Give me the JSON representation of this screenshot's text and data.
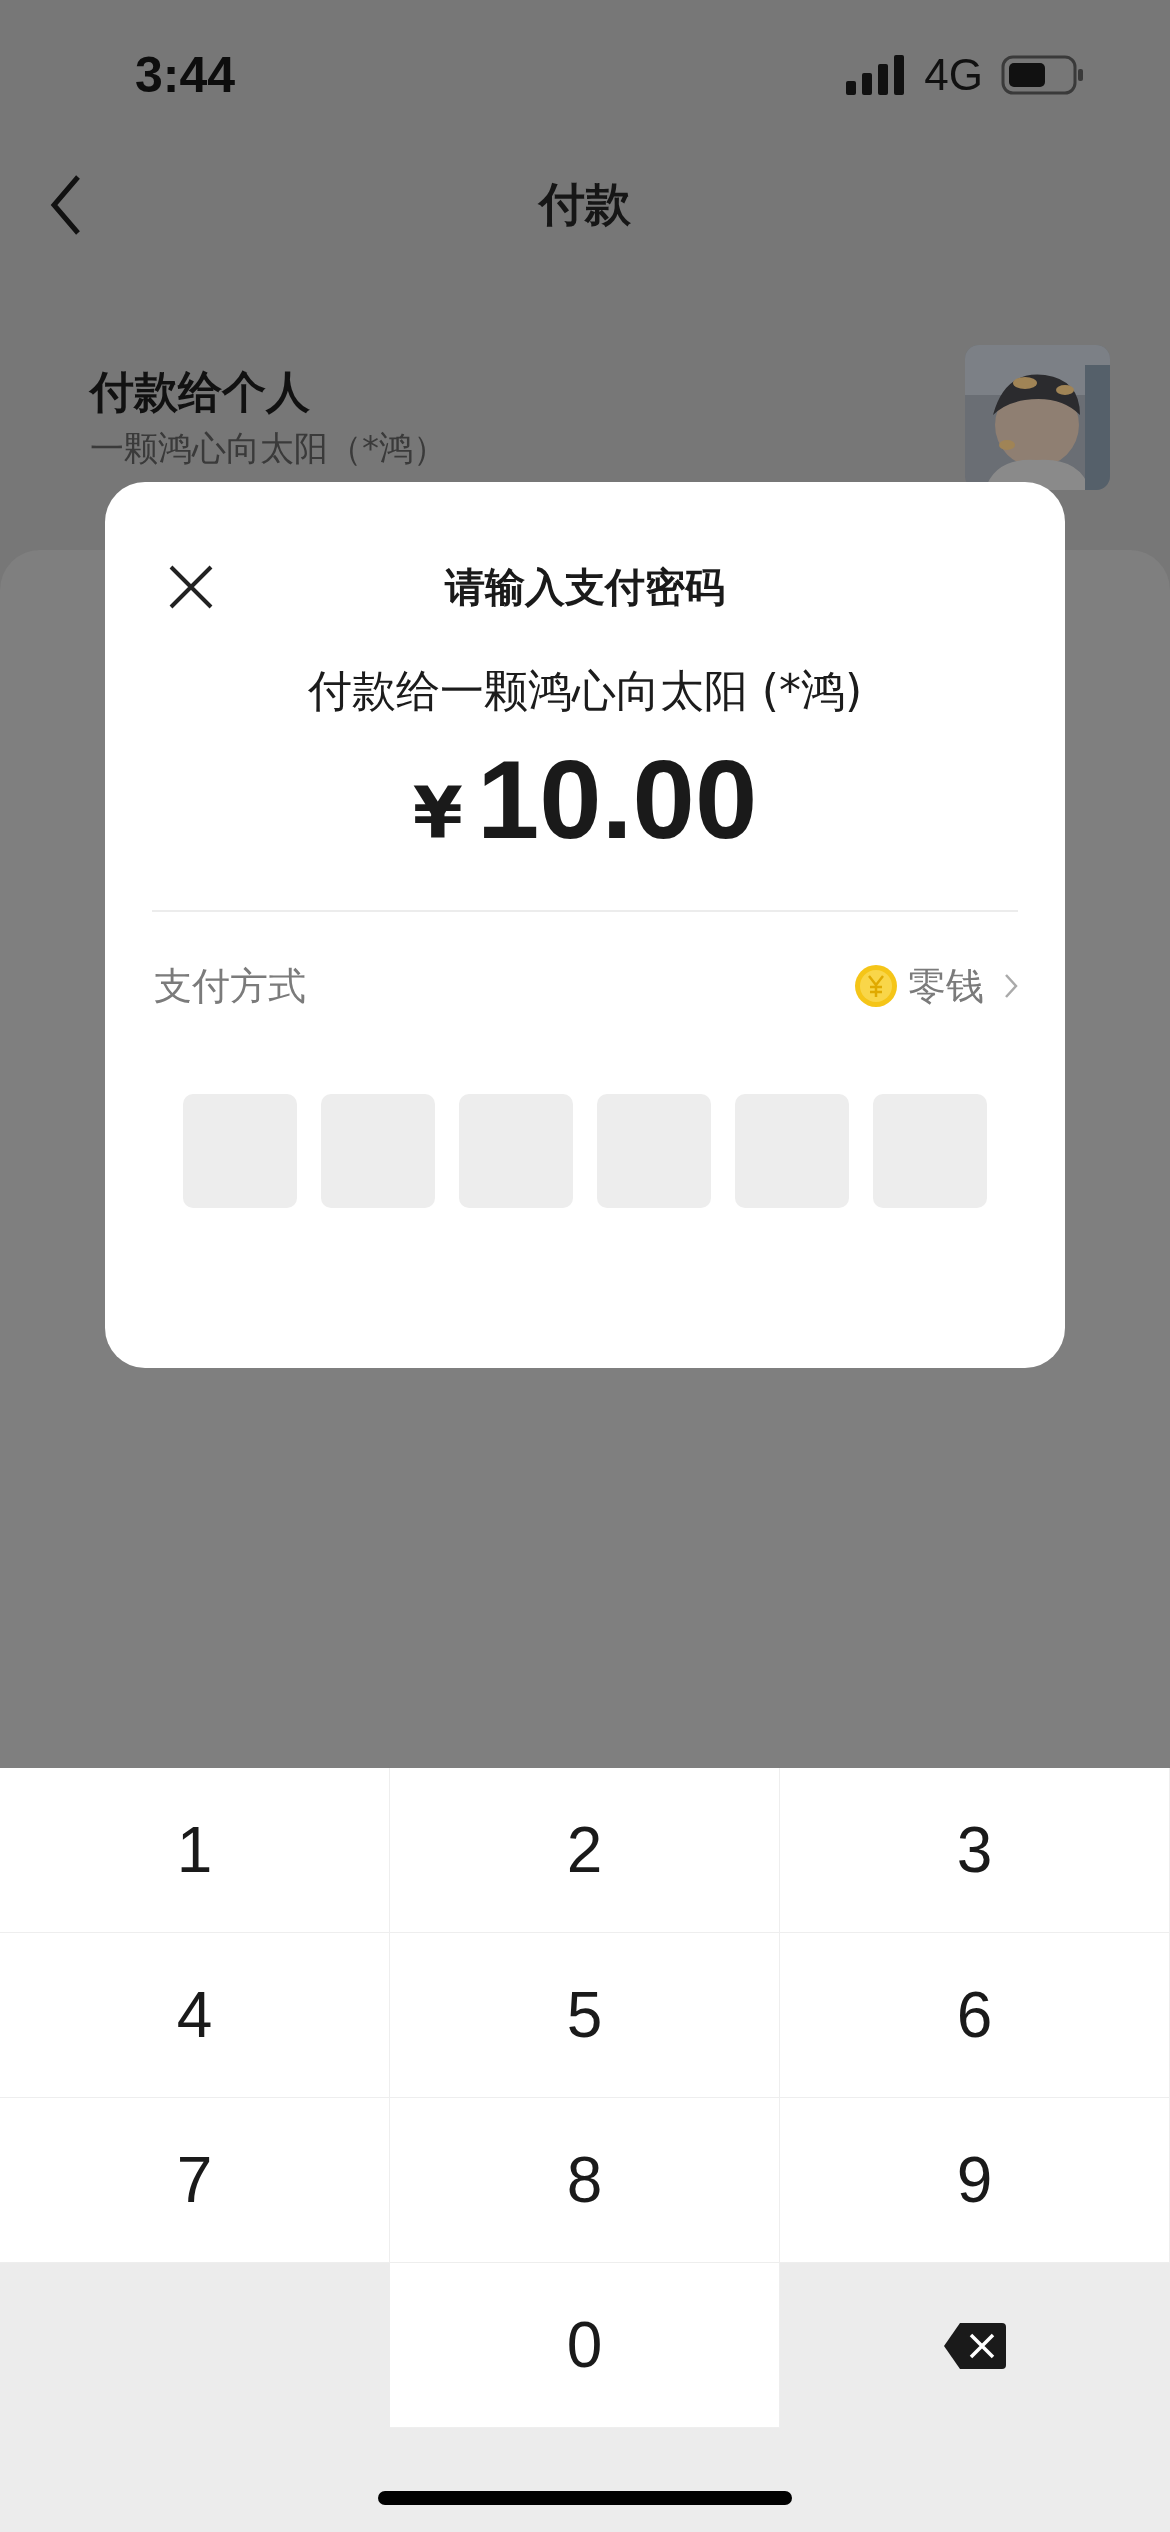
{
  "status_bar": {
    "time": "3:44",
    "network": "4G"
  },
  "nav": {
    "title": "付款"
  },
  "payee": {
    "title": "付款给个人",
    "name": "一颗鸿心向太阳（*鸿）"
  },
  "dialog": {
    "title": "请输入支付密码",
    "payee_line": "付款给一颗鸿心向太阳 (*鸿)",
    "currency": "¥",
    "amount": "10.00",
    "method_label": "支付方式",
    "method_value": "零钱",
    "pin_boxes": [
      {
        "filled": false
      },
      {
        "filled": false
      },
      {
        "filled": false
      },
      {
        "filled": false
      },
      {
        "filled": false
      },
      {
        "filled": false
      }
    ]
  },
  "keypad": {
    "keys": [
      {
        "kind": "digit",
        "label": "1"
      },
      {
        "kind": "digit",
        "label": "2"
      },
      {
        "kind": "digit",
        "label": "3"
      },
      {
        "kind": "digit",
        "label": "4"
      },
      {
        "kind": "digit",
        "label": "5"
      },
      {
        "kind": "digit",
        "label": "6"
      },
      {
        "kind": "digit",
        "label": "7"
      },
      {
        "kind": "digit",
        "label": "8"
      },
      {
        "kind": "digit",
        "label": "9"
      },
      {
        "kind": "blank"
      },
      {
        "kind": "digit",
        "label": "0"
      },
      {
        "kind": "delete"
      }
    ]
  }
}
